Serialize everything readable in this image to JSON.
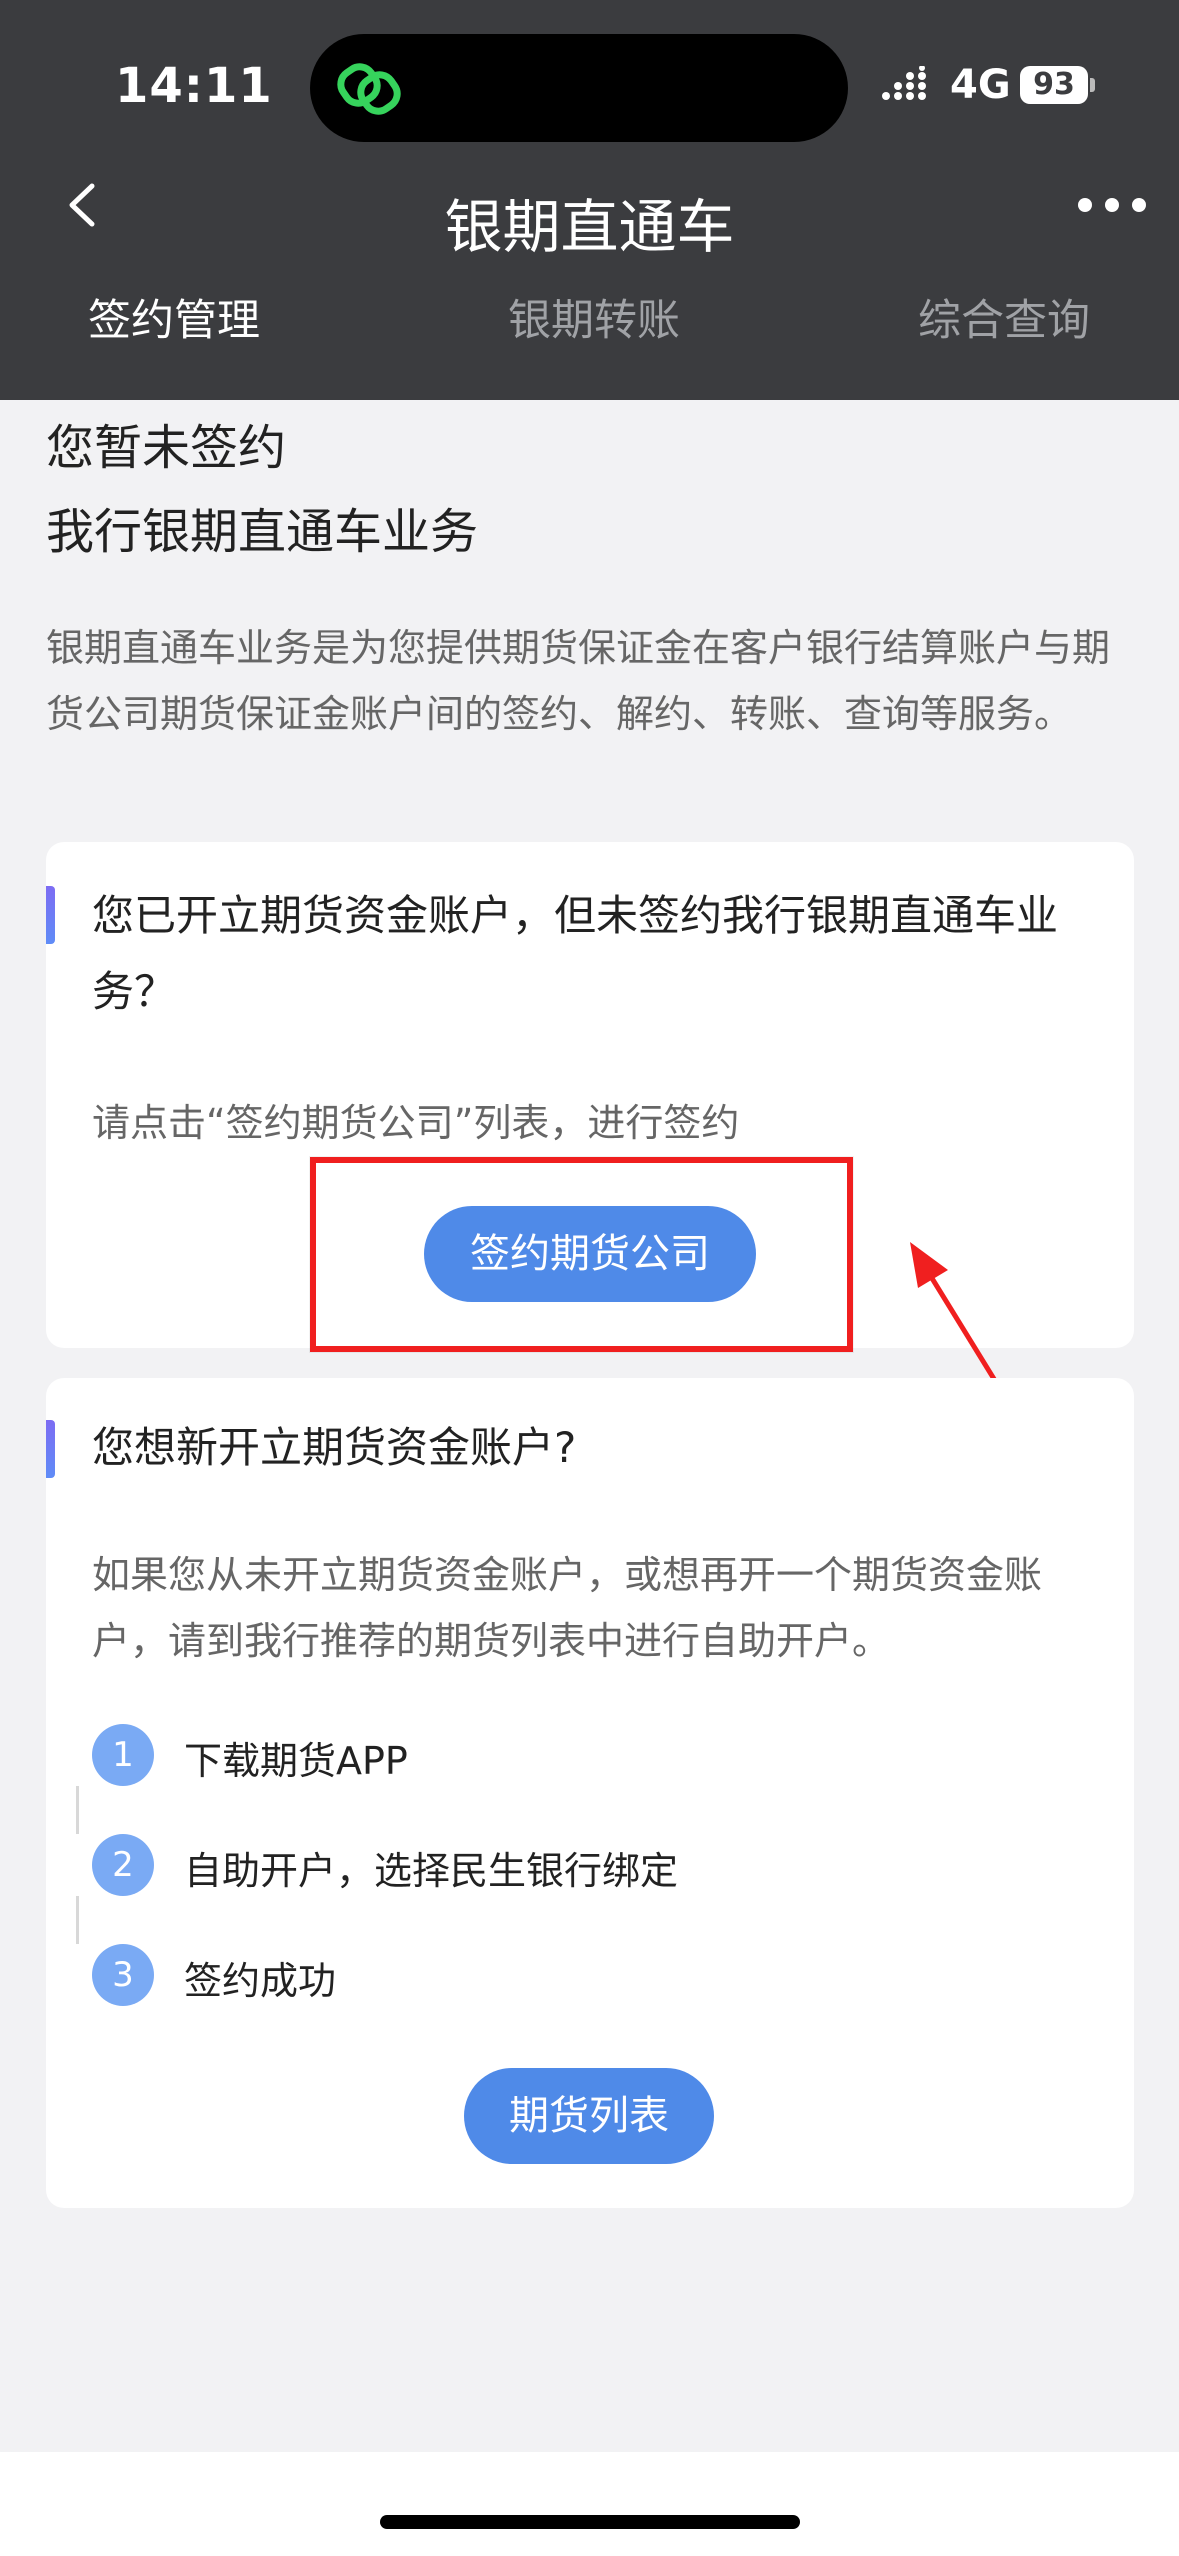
{
  "status": {
    "time": "14:11",
    "network": "4G",
    "battery": "93"
  },
  "nav": {
    "title": "银期直通车",
    "tabs": [
      {
        "label": "签约管理",
        "active": true
      },
      {
        "label": "银期转账",
        "active": false
      },
      {
        "label": "综合查询",
        "active": false
      }
    ]
  },
  "intro": {
    "line1": "您暂未签约",
    "line2": "我行银期直通车业务",
    "description": "银期直通车业务是为您提供期货保证金在客户银行结算账户与期货公司期货保证金账户间的签约、解约、转账、查询等服务。"
  },
  "card1": {
    "title": "您已开立期货资金账户，但未签约我行银期直通车业务？",
    "hint": "请点击“签约期货公司”列表，进行签约",
    "button": "签约期货公司"
  },
  "card2": {
    "title": "您想新开立期货资金账户?",
    "description": "如果您从未开立期货资金账户，或想再开一个期货资金账户，请到我行推荐的期货列表中进行自助开户。",
    "steps": [
      {
        "num": "1",
        "label": "下载期货APP"
      },
      {
        "num": "2",
        "label": "自助开户，选择民生银行绑定"
      },
      {
        "num": "3",
        "label": "签约成功"
      }
    ],
    "button": "期货列表"
  },
  "colors": {
    "header_bg": "#3b3c3f",
    "primary": "#4f8ae8",
    "highlight": "#f01f1f"
  }
}
